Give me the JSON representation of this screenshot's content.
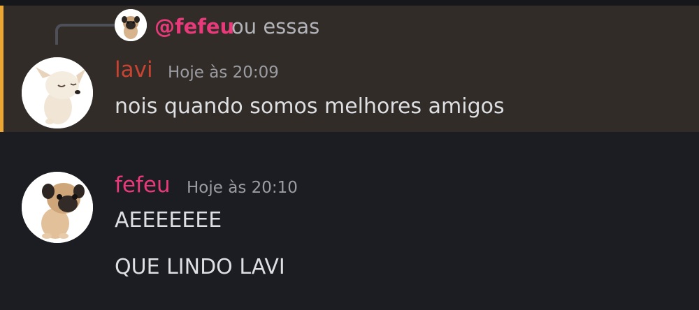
{
  "reply": {
    "author": "@fefeu",
    "text": "ou essas"
  },
  "messages": [
    {
      "author": "lavi",
      "timestamp": "Hoje às 20:09",
      "lines": [
        "nois quando somos melhores amigos"
      ],
      "author_color": "#c94332",
      "highlighted": true
    },
    {
      "author": "fefeu",
      "timestamp": "Hoje às 20:10",
      "lines": [
        "AEEEEEEE",
        "QUE LINDO LAVI"
      ],
      "author_color": "#e83a7a"
    }
  ],
  "colors": {
    "background": "#1c1d22",
    "highlight_background": "#312c28",
    "highlight_accent": "#eba734",
    "mention": "#e83a7a"
  },
  "icons": {
    "lavi_avatar": "chihuahua-puppy-avatar",
    "fefeu_avatar": "pug-puppy-avatar"
  }
}
